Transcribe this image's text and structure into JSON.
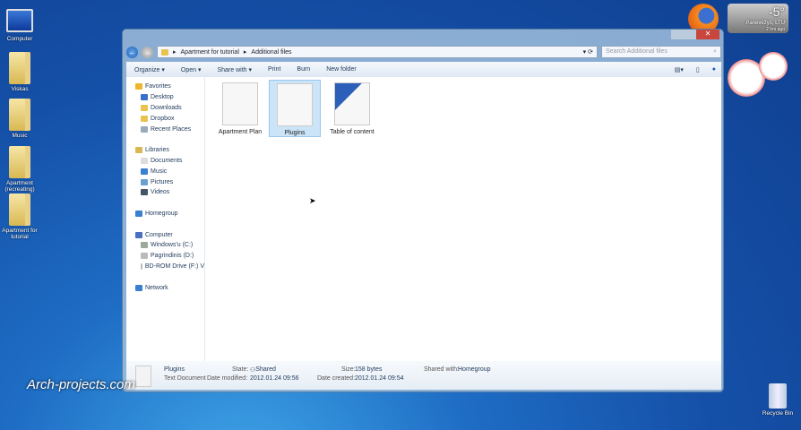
{
  "desktop": {
    "icons": [
      "Computer",
      "Viskas",
      "Music",
      "Apartment (recreating)",
      "Apartment for tutorial"
    ],
    "recycle_bin": "Recycle Bin",
    "watermark": "Arch-projects.com"
  },
  "weather": {
    "temp": "-5°",
    "location": "Panevėžys, LTU",
    "updated": "2 hrs ago"
  },
  "window": {
    "breadcrumb": [
      "Apartment for tutorial",
      "Additional files"
    ],
    "search_placeholder": "Search Additional files",
    "toolbar": {
      "organize": "Organize ▾",
      "open": "Open ▾",
      "share": "Share with ▾",
      "print": "Print",
      "burn": "Burn",
      "new_folder": "New folder"
    },
    "sidebar": {
      "favorites": "Favorites",
      "fav_items": [
        "Desktop",
        "Downloads",
        "Dropbox",
        "Recent Places"
      ],
      "libraries": "Libraries",
      "lib_items": [
        "Documents",
        "Music",
        "Pictures",
        "Videos"
      ],
      "homegroup": "Homegroup",
      "computer": "Computer",
      "comp_items": [
        "Windows'u (C:)",
        "Pagrindinis (D:)",
        "BD-ROM Drive (F:) V"
      ],
      "network": "Network"
    },
    "files": [
      {
        "name": "Apartment Plan"
      },
      {
        "name": "Plugins",
        "selected": true
      },
      {
        "name": "Table of content"
      }
    ],
    "details": {
      "name": "Plugins",
      "type": "Text Document",
      "state_label": "State:",
      "state": "Shared",
      "modified_label": "Date modified:",
      "modified": "2012.01.24 09:56",
      "size_label": "Size:",
      "size": "158 bytes",
      "created_label": "Date created:",
      "created": "2012.01.24 09:54",
      "shared_label": "Shared with:",
      "shared": "Homegroup"
    }
  }
}
